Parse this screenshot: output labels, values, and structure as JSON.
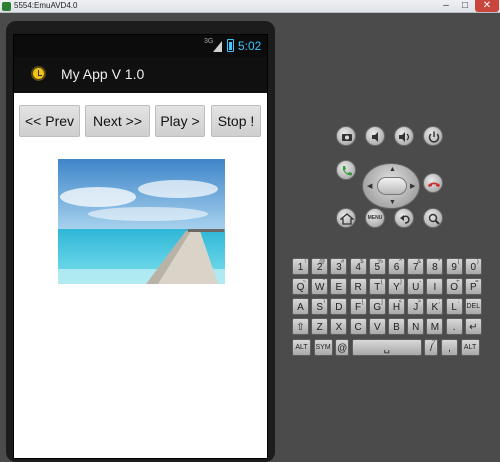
{
  "window": {
    "title": "5554:EmuAVD4.0",
    "minimize": "–",
    "maximize": "□",
    "close": "✕"
  },
  "status_bar": {
    "network": "3G",
    "time": "5:02"
  },
  "action_bar": {
    "title": "My App V 1.0",
    "icon": "clock-icon"
  },
  "buttons": {
    "prev": "<< Prev",
    "next": "Next >>",
    "play": "Play >",
    "stop": "Stop !"
  },
  "controls": {
    "camera": "camera-icon",
    "volume_down": "volume-down-icon",
    "volume_up": "volume-up-icon",
    "power": "power-icon",
    "call": "call-icon",
    "end_call": "end-call-icon",
    "home": "home-icon",
    "menu": "MENU",
    "back": "back-icon",
    "search": "search-icon"
  },
  "keyboard": {
    "row1": [
      {
        "main": "1",
        "sub": "!"
      },
      {
        "main": "2",
        "sub": "@"
      },
      {
        "main": "3",
        "sub": "#"
      },
      {
        "main": "4",
        "sub": "$"
      },
      {
        "main": "5",
        "sub": "%"
      },
      {
        "main": "6",
        "sub": "^"
      },
      {
        "main": "7",
        "sub": "&"
      },
      {
        "main": "8",
        "sub": "*"
      },
      {
        "main": "9",
        "sub": "("
      },
      {
        "main": "0",
        "sub": ")"
      }
    ],
    "row2": [
      {
        "main": "Q",
        "sub": "~"
      },
      {
        "main": "W",
        "sub": "\""
      },
      {
        "main": "E",
        "sub": "´"
      },
      {
        "main": "R",
        "sub": ""
      },
      {
        "main": "T",
        "sub": "{"
      },
      {
        "main": "Y",
        "sub": "}"
      },
      {
        "main": "U",
        "sub": "-"
      },
      {
        "main": "I",
        "sub": ""
      },
      {
        "main": "O",
        "sub": "+"
      },
      {
        "main": "P",
        "sub": "="
      }
    ],
    "row3": [
      {
        "main": "A",
        "sub": ""
      },
      {
        "main": "S",
        "sub": "\\"
      },
      {
        "main": "D",
        "sub": "`"
      },
      {
        "main": "F",
        "sub": "["
      },
      {
        "main": "G",
        "sub": "]"
      },
      {
        "main": "H",
        "sub": "<"
      },
      {
        "main": "J",
        "sub": ">"
      },
      {
        "main": "K",
        "sub": ";"
      },
      {
        "main": "L",
        "sub": ":"
      },
      {
        "main": "DEL",
        "sub": ""
      }
    ],
    "row4": [
      {
        "main": "⇧",
        "sub": ""
      },
      {
        "main": "Z",
        "sub": ""
      },
      {
        "main": "X",
        "sub": ""
      },
      {
        "main": "C",
        "sub": ""
      },
      {
        "main": "V",
        "sub": ""
      },
      {
        "main": "B",
        "sub": ""
      },
      {
        "main": "N",
        "sub": ""
      },
      {
        "main": "M",
        "sub": ""
      },
      {
        "main": ".",
        "sub": ""
      },
      {
        "main": "↵",
        "sub": ""
      }
    ],
    "row5": [
      {
        "main": "ALT",
        "sub": ""
      },
      {
        "main": "SYM",
        "sub": ""
      },
      {
        "main": "@",
        "sub": ""
      },
      {
        "main": "␣",
        "sub": ""
      },
      {
        "main": "/",
        "sub": "?"
      },
      {
        "main": ",",
        "sub": ""
      },
      {
        "main": "ALT",
        "sub": ""
      }
    ]
  },
  "colors": {
    "accent": "#3ec6ff",
    "call_green": "#2f9a3a",
    "end_call_red": "#c9302c"
  }
}
